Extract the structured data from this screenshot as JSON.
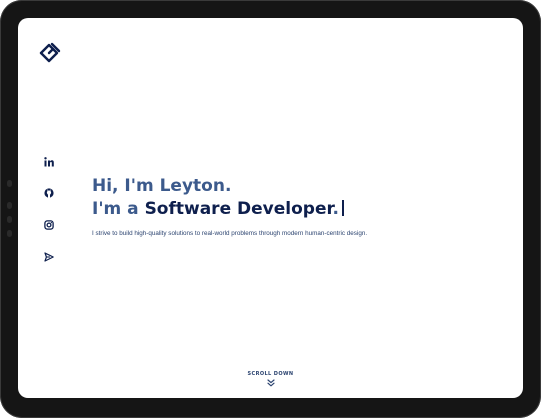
{
  "icons": {
    "logo": "logo-mark",
    "social": [
      "linkedin-icon",
      "github-icon",
      "instagram-icon",
      "send-icon"
    ],
    "scroll": "double-chevron-down-icon"
  },
  "colors": {
    "accent_light": "#3c5a8c",
    "accent_dark": "#0e1f4d",
    "text": "#2c4470"
  },
  "hero": {
    "greeting": "Hi, I'm Leyton.",
    "role_prefix": "I'm a ",
    "role": "Software Developer",
    "role_suffix": ".",
    "tagline": "I strive to build high-quality solutions to real-world problems through modern human-centric design."
  },
  "scroll": {
    "label": "SCROLL DOWN"
  }
}
